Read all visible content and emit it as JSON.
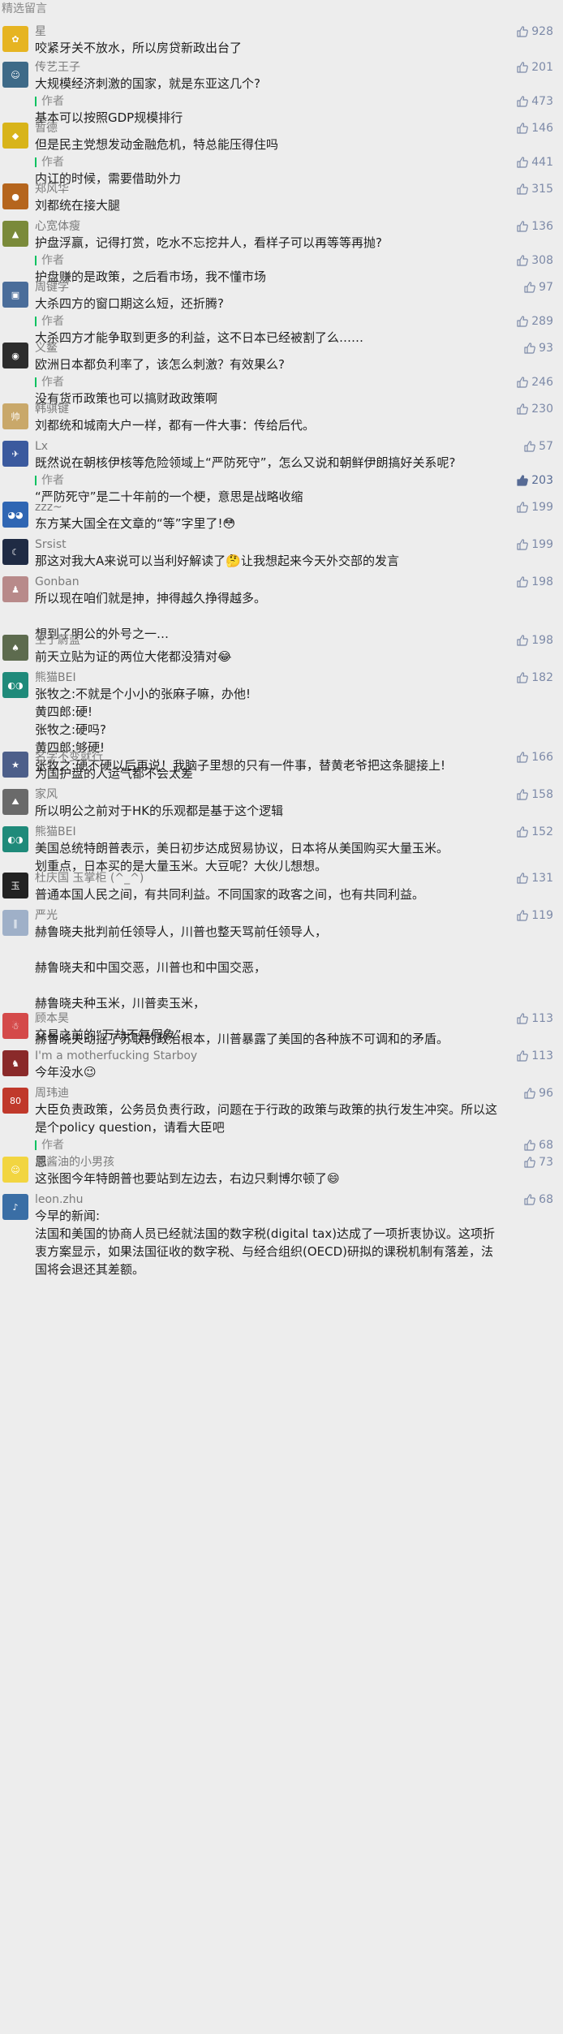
{
  "section_title": "精选留言",
  "comments": [
    {
      "name": "星",
      "text": "咬紧牙关不放水，所以房贷新政出台了",
      "likes": "928",
      "avatar_color": "#e6b422",
      "avatar_glyph": "✿"
    },
    {
      "name": "传艺王子",
      "text": "大规模经济刺激的国家，就是东亚这几个?",
      "likes": "201",
      "avatar_color": "#3e6a88",
      "avatar_glyph": "☺",
      "reply": {
        "author_label": "作者",
        "text": "基本可以按照GDP规模排行",
        "likes": "473"
      }
    },
    {
      "name": "暂德",
      "text": "但是民主党想发动金融危机，特总能压得住吗",
      "likes": "146",
      "avatar_color": "#d8b41a",
      "avatar_glyph": "◆",
      "reply": {
        "author_label": "作者",
        "text": "内讧的时候，需要借助外力",
        "likes": "441"
      }
    },
    {
      "name": "郑风华",
      "text": "刘都统在接大腿",
      "likes": "315",
      "avatar_color": "#b5651d",
      "avatar_glyph": "●"
    },
    {
      "name": "心宽体瘦",
      "text": "护盘浮赢，记得打赏，吃水不忘挖井人，看样子可以再等等再抛?",
      "likes": "136",
      "avatar_color": "#7a8a3a",
      "avatar_glyph": "▲",
      "reply": {
        "author_label": "作者",
        "text": "护盘赚的是政策，之后看市场，我不懂市场",
        "likes": "308"
      }
    },
    {
      "name": "周键学",
      "text": "大杀四方的窗口期这么短，还折腾?",
      "likes": "97",
      "avatar_color": "#4a6d9a",
      "avatar_glyph": "▣",
      "reply": {
        "author_label": "作者",
        "text": "大杀四方才能争取到更多的利益，这不日本已经被割了么……",
        "likes": "289"
      }
    },
    {
      "name": "义鳌",
      "text": "欧洲日本都负利率了，该怎么刺激？有效果么?",
      "likes": "93",
      "avatar_color": "#2d2d2d",
      "avatar_glyph": "◉",
      "reply": {
        "author_label": "作者",
        "text": "没有货币政策也可以搞财政政策啊",
        "likes": "246"
      }
    },
    {
      "name": "韩骐键",
      "text": "刘都统和城南大户一样，都有一件大事：传给后代。",
      "likes": "230",
      "avatar_color": "#c9a86a",
      "avatar_glyph": "帅"
    },
    {
      "name": "Lx",
      "text": "既然说在朝核伊核等危险领域上“严防死守”，怎么又说和朝鲜伊朗搞好关系呢?",
      "likes": "57",
      "avatar_color": "#3b5a9e",
      "avatar_glyph": "✈",
      "reply": {
        "author_label": "作者",
        "text": "“严防死守”是二十年前的一个梗，意思是战略收缩",
        "likes": "203",
        "filled": true
      }
    },
    {
      "name": "zzz~",
      "text": "东方某大国全在文章的“等”字里了!😳",
      "likes": "199",
      "avatar_color": "#2f66b3",
      "avatar_glyph": "◕◕"
    },
    {
      "name": "Srsist",
      "text": "那这对我大A来说可以当利好解读了🤔让我想起来今天外交部的发言",
      "likes": "199",
      "avatar_color": "#1f2b44",
      "avatar_glyph": "☾"
    },
    {
      "name": "Gonban",
      "text": "所以现在咱们就是抻，抻得越久挣得越多。\n\n想到了明公的外号之一…",
      "likes": "198",
      "avatar_color": "#b88a8a",
      "avatar_glyph": "♟"
    },
    {
      "name": "生于蔚蓝",
      "text": "前天立贴为证的两位大佬都没猜对😂",
      "likes": "198",
      "avatar_color": "#5d6b4e",
      "avatar_glyph": "♠"
    },
    {
      "name": "熊猫BEI",
      "text": "张牧之:不就是个小小的张麻子嘛，办他!\n黄四郎:硬!\n张牧之:硬吗?\n黄四郎:够硬!\n张牧之:硬不硬以后再说！我脑子里想的只有一件事，替黄老爷把这条腿接上!",
      "likes": "182",
      "avatar_color": "#1f8a7a",
      "avatar_glyph": "◐◑"
    },
    {
      "name": "名字不变就行",
      "text": "为国护盘的人运气都不会太差",
      "likes": "166",
      "avatar_color": "#4d5f8a",
      "avatar_glyph": "★"
    },
    {
      "name": "家风",
      "text": "所以明公之前对于HK的乐观都是基于这个逻辑",
      "likes": "158",
      "avatar_color": "#6a6a6a",
      "avatar_glyph": "⛰"
    },
    {
      "name": "熊猫BEI",
      "text": "美国总统特朗普表示，美日初步达成贸易协议，日本将从美国购买大量玉米。\n划重点，日本买的是大量玉米。大豆呢？大伙儿想想。",
      "likes": "152",
      "avatar_color": "#1f8a7a",
      "avatar_glyph": "◐◑"
    },
    {
      "name": "杜庆国 玉掌柜 (^_^)",
      "text": "普通本国人民之间，有共同利益。不同国家的政客之间，也有共同利益。",
      "likes": "131",
      "avatar_color": "#222222",
      "avatar_glyph": "玉"
    },
    {
      "name": "严光",
      "text": "赫鲁晓夫批判前任领导人，川普也整天骂前任领导人，\n\n赫鲁晓夫和中国交恶，川普也和中国交恶，\n\n赫鲁晓夫种玉米，川普卖玉米，\n\n赫鲁晓夫动摇了苏联的政治根本，川普暴露了美国的各种族不可调和的矛盾。",
      "likes": "119",
      "avatar_color": "#9fb0c8",
      "avatar_glyph": "‖"
    },
    {
      "name": "顾本昊",
      "text": "交易之前的“万劫不复假象”",
      "likes": "113",
      "avatar_color": "#d44a4a",
      "avatar_glyph": "☃"
    },
    {
      "name": "I'm a motherfucking Starboy",
      "text": "今年没水😉",
      "likes": "113",
      "avatar_color": "#8a2a2a",
      "avatar_glyph": "♞"
    },
    {
      "name": "周玮迪",
      "text": "大臣负责政策，公务员负责行政，问题在于行政的政策与政策的执行发生冲突。所以这是个policy question，请看大臣吧",
      "likes": "96",
      "avatar_color": "#c0392b",
      "avatar_glyph": "80",
      "reply": {
        "author_label": "作者",
        "text": "恩",
        "likes": "68"
      }
    },
    {
      "name": "卖酱油的小男孩",
      "text": "这张图今年特朗普也要站到左边去，右边只剩博尔顿了😄",
      "likes": "73",
      "avatar_color": "#f2d541",
      "avatar_glyph": "☺"
    },
    {
      "name": "leon.zhu",
      "text": "今早的新闻:\n法国和美国的协商人员已经就法国的数字税(digital tax)达成了一项折衷协议。这项折衷方案显示，如果法国征收的数字税、与经合组织(OECD)研拟的课税机制有落差，法国将会退还其差额。",
      "likes": "68",
      "avatar_color": "#3a6ea5",
      "avatar_glyph": "♪"
    }
  ]
}
